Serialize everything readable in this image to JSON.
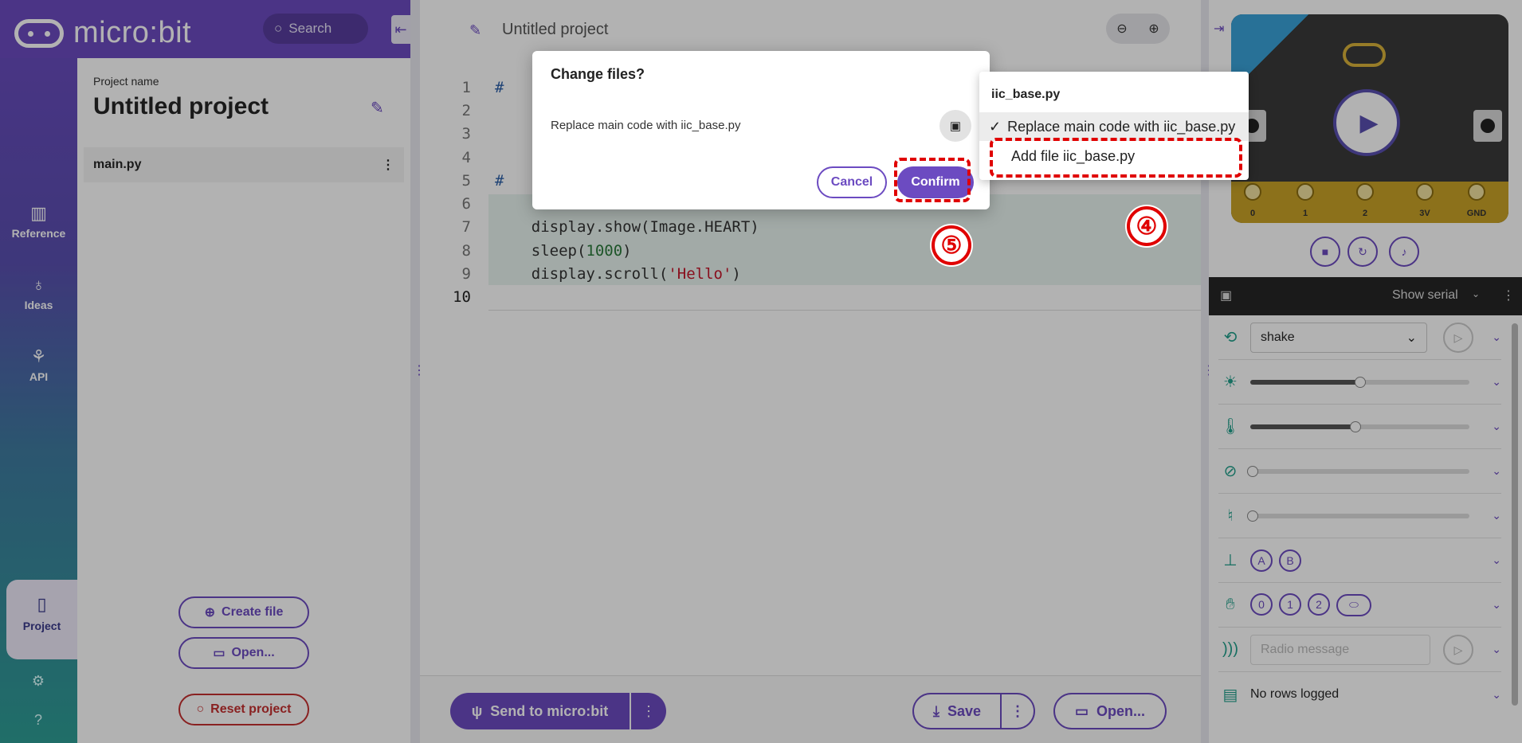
{
  "app": {
    "brand": "micro:bit"
  },
  "header": {
    "search_placeholder": "Search"
  },
  "nav": {
    "reference": "Reference",
    "ideas": "Ideas",
    "api": "API",
    "project": "Project"
  },
  "project_panel": {
    "label": "Project name",
    "title": "Untitled project",
    "file": "main.py",
    "create_file": "Create file",
    "open": "Open...",
    "reset": "Reset project"
  },
  "editor": {
    "title": "Untitled project",
    "line_numbers": [
      "1",
      "2",
      "3",
      "4",
      "5",
      "6",
      "7",
      "8",
      "9",
      "10"
    ],
    "send_label": "Send to micro:bit",
    "save_label": "Save",
    "open_label": "Open..."
  },
  "simulator": {
    "pins": [
      "0",
      "1",
      "2",
      "3V",
      "GND"
    ],
    "serial_label": "Show serial",
    "gesture": "shake",
    "buttons": [
      "A",
      "B"
    ],
    "touch_pins": [
      "0",
      "1",
      "2"
    ],
    "radio_placeholder": "Radio message",
    "log_text": "No rows logged",
    "light_level": 0.5,
    "temperature_level": 0.48
  },
  "modal": {
    "title": "Change files?",
    "text": "Replace main code with iic_base.py",
    "cancel": "Cancel",
    "confirm": "Confirm"
  },
  "dropdown": {
    "heading": "iic_base.py",
    "option_selected": "Replace main code with iic_base.py",
    "option_other": "Add file iic_base.py"
  },
  "annotations": {
    "step4": "④",
    "step5": "⑤"
  },
  "colors": {
    "brand": "#6c4bc1",
    "highlight": "#e00000",
    "accent_teal": "#22a08b"
  }
}
